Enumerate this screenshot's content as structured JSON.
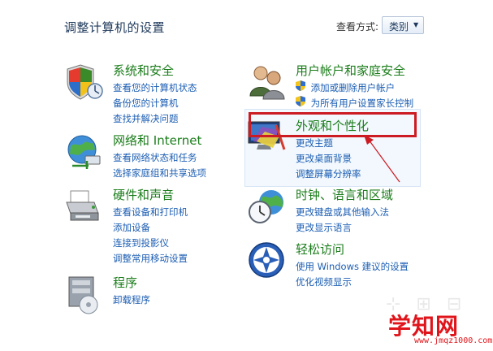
{
  "header": {
    "title": "调整计算机的设置",
    "view_by_label": "查看方式:",
    "view_by_value": "类别"
  },
  "categories": {
    "system": {
      "title": "系统和安全",
      "icon": "security-shield-icon",
      "links": [
        "查看您的计算机状态",
        "备份您的计算机",
        "查找并解决问题"
      ]
    },
    "network": {
      "title": "网络和 Internet",
      "icon": "network-globe-icon",
      "links": [
        "查看网络状态和任务",
        "选择家庭组和共享选项"
      ]
    },
    "hardware": {
      "title": "硬件和声音",
      "icon": "printer-icon",
      "links": [
        "查看设备和打印机",
        "添加设备",
        "连接到投影仪",
        "调整常用移动设置"
      ]
    },
    "programs": {
      "title": "程序",
      "icon": "programs-disc-icon",
      "links": [
        "卸载程序"
      ]
    },
    "users": {
      "title": "用户帐户和家庭安全",
      "icon": "users-icon",
      "links": [
        "添加或删除用户帐户",
        "为所有用户设置家长控制"
      ]
    },
    "appearance": {
      "title": "外观和个性化",
      "icon": "appearance-monitor-icon",
      "links": [
        "更改主题",
        "更改桌面背景",
        "调整屏幕分辨率"
      ]
    },
    "clock": {
      "title": "时钟、语言和区域",
      "icon": "clock-globe-icon",
      "links": [
        "更改键盘或其他输入法",
        "更改显示语言"
      ]
    },
    "ease": {
      "title": "轻松访问",
      "icon": "ease-of-access-icon",
      "links": [
        "使用 Windows 建议的设置",
        "优化视频显示"
      ]
    }
  },
  "watermark": {
    "text": "学知网",
    "url": "www.jmqz1000.com"
  },
  "colors": {
    "category_title": "#1b7d1b",
    "link": "#1c5eb3",
    "highlight_box": "#cc1b22",
    "watermark": "#e0151b"
  }
}
